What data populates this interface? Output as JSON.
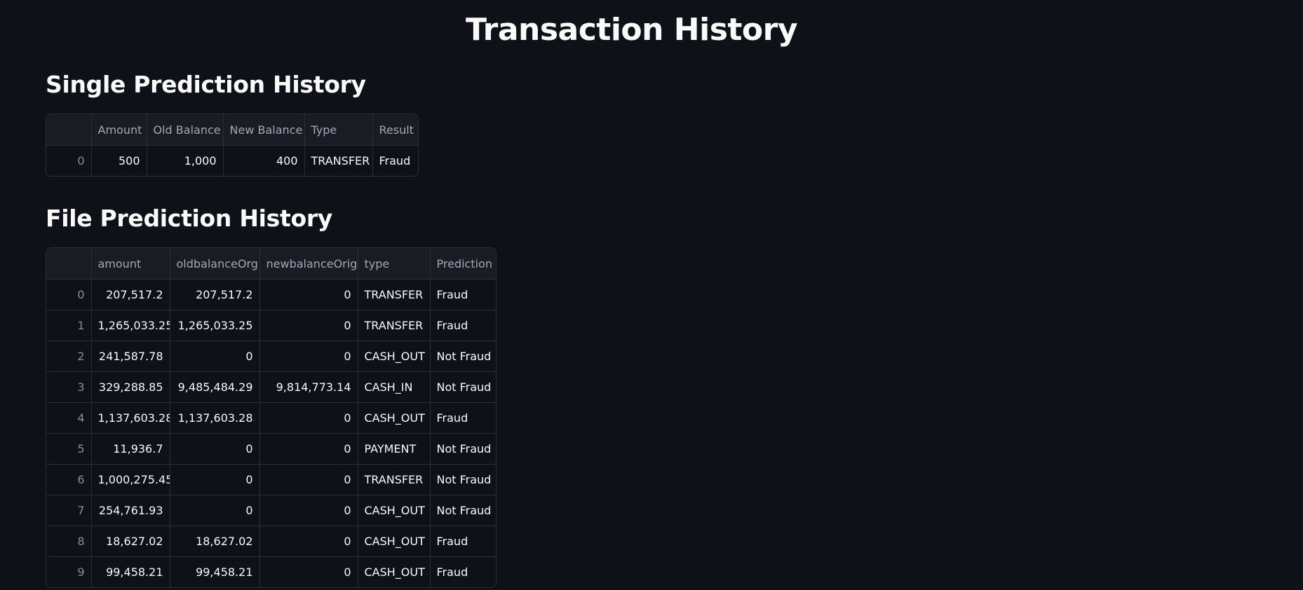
{
  "page": {
    "title": "Transaction History"
  },
  "single": {
    "title": "Single Prediction History",
    "columns": [
      "",
      "Amount",
      "Old Balance",
      "New Balance",
      "Type",
      "Result"
    ],
    "rows": [
      [
        "0",
        "500",
        "1,000",
        "400",
        "TRANSFER",
        "Fraud"
      ]
    ]
  },
  "file": {
    "title": "File Prediction History",
    "columns": [
      "",
      "amount",
      "oldbalanceOrg",
      "newbalanceOrig",
      "type",
      "Prediction"
    ],
    "rows": [
      [
        "0",
        "207,517.2",
        "207,517.2",
        "0",
        "TRANSFER",
        "Fraud"
      ],
      [
        "1",
        "1,265,033.25",
        "1,265,033.25",
        "0",
        "TRANSFER",
        "Fraud"
      ],
      [
        "2",
        "241,587.78",
        "0",
        "0",
        "CASH_OUT",
        "Not Fraud"
      ],
      [
        "3",
        "329,288.85",
        "9,485,484.29",
        "9,814,773.14",
        "CASH_IN",
        "Not Fraud"
      ],
      [
        "4",
        "1,137,603.28",
        "1,137,603.28",
        "0",
        "CASH_OUT",
        "Fraud"
      ],
      [
        "5",
        "11,936.7",
        "0",
        "0",
        "PAYMENT",
        "Not Fraud"
      ],
      [
        "6",
        "1,000,275.45",
        "0",
        "0",
        "TRANSFER",
        "Not Fraud"
      ],
      [
        "7",
        "254,761.93",
        "0",
        "0",
        "CASH_OUT",
        "Not Fraud"
      ],
      [
        "8",
        "18,627.02",
        "18,627.02",
        "0",
        "CASH_OUT",
        "Fraud"
      ],
      [
        "9",
        "99,458.21",
        "99,458.21",
        "0",
        "CASH_OUT",
        "Fraud"
      ]
    ]
  }
}
